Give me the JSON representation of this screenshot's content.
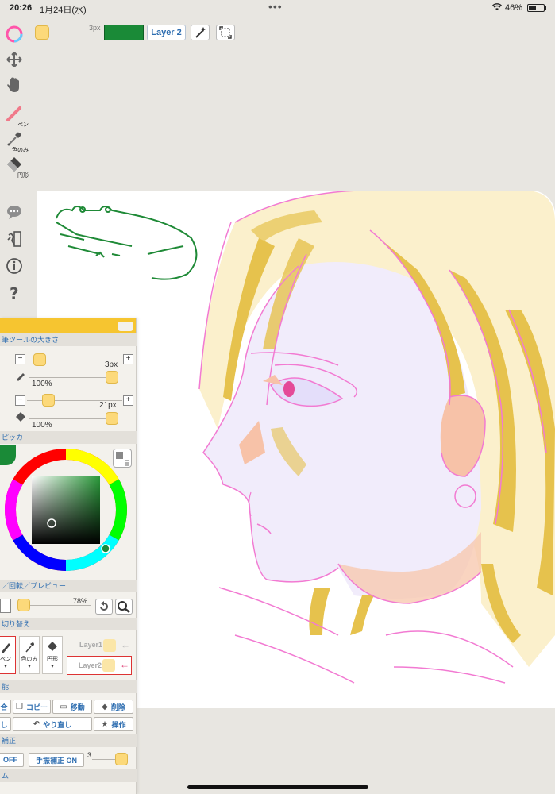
{
  "status": {
    "time": "20:26",
    "date": "1月24日(水)",
    "dots": "•••",
    "battery_pct": "46%"
  },
  "toolbar": {
    "brush_size": "3px",
    "layer_label": "Layer 2",
    "current_color": "#1a8a37"
  },
  "left_tools": {
    "pen_label": "ペン",
    "picker_label": "色のみ",
    "shape_label": "円形"
  },
  "panel": {
    "sec_brush": "筆ツールの大きさ",
    "pen_size": "3px",
    "pen_opacity": "100%",
    "eraser_size": "21px",
    "eraser_opacity": "100%",
    "sec_picker": "ピッカー",
    "sec_view": "／回転／プレビュー",
    "zoom": "78%",
    "sec_switch": "切り替え",
    "tool_pen": "ペン",
    "tool_picker": "色のみ",
    "tool_shape": "円形",
    "layer1": "Layer1",
    "layer2": "Layer2",
    "sec_func": "能",
    "btn_merge": "合",
    "btn_copy": "コピー",
    "btn_move": "移動",
    "btn_delete": "削除",
    "btn_undo": "し",
    "btn_redo": "やり直し",
    "btn_ops": "操作",
    "sec_stab": "補正",
    "btn_off": "OFF",
    "btn_stab": "手振補正 ON",
    "stab_value": "3",
    "sec_last": "ム"
  }
}
